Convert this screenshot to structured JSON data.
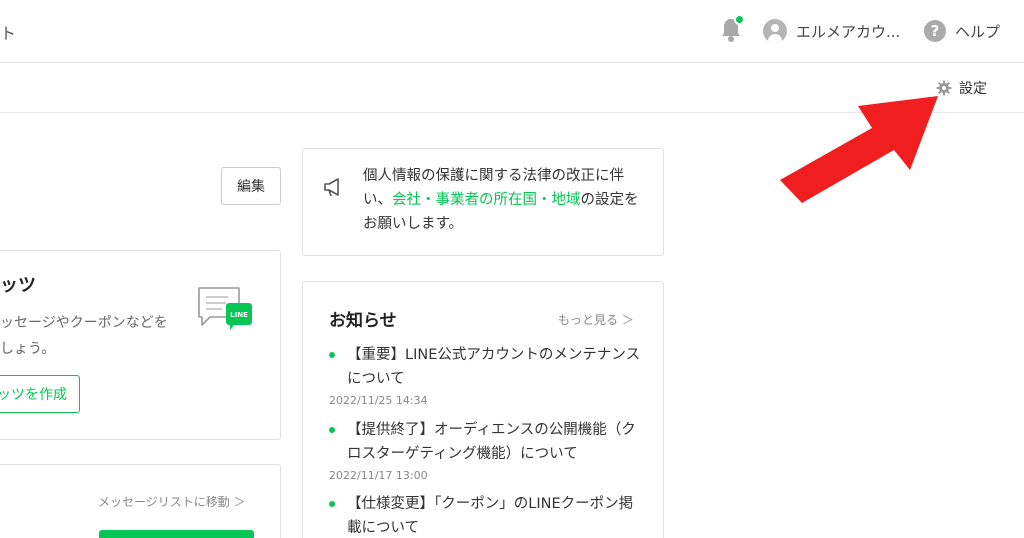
{
  "topbar": {
    "left_text": "ト",
    "account_name": "エルメアカウ...",
    "help_label": "ヘルプ"
  },
  "subbar": {
    "settings_label": "設定"
  },
  "left": {
    "edit_label": "編集",
    "card_title": "ッツ",
    "card_desc_line1": "ッセージやクーポンなどを",
    "card_desc_line2": "しょう。",
    "create_button": "ッツを作成",
    "line_badge": "LINE",
    "message_list_link": "メッセージリストに移動 ＞"
  },
  "notice": {
    "text_before": "個人情報の保護に関する法律の改正に伴い、",
    "link_text": "会社・事業者の所在国・地域",
    "text_after": "の設定をお願いします。"
  },
  "news": {
    "title": "お知らせ",
    "more_link": "もっと見る ＞",
    "items": [
      {
        "title": "【重要】LINE公式アカウントのメンテナンスについて",
        "date": "2022/11/25 14:34"
      },
      {
        "title": "【提供終了】オーディエンスの公開機能（クロスターゲティング機能）について",
        "date": "2022/11/17 13:00"
      },
      {
        "title": "【仕様変更】「クーポン」のLINEクーポン掲載について",
        "date": ""
      }
    ]
  },
  "colors": {
    "accent_green": "#06c755",
    "annotation_arrow": "#f01e1e"
  }
}
